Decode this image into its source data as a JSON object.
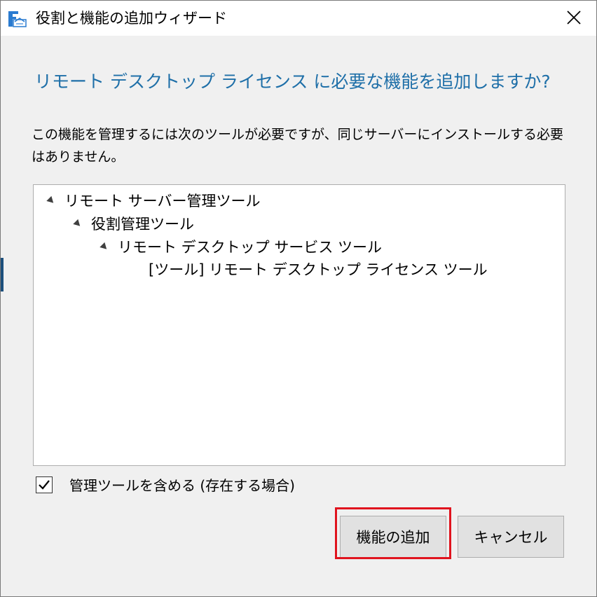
{
  "window": {
    "title": "役割と機能の追加ウィザード",
    "app_icon": "server-manager-icon",
    "close_icon": "close-icon"
  },
  "dialog": {
    "heading": "リモート デスクトップ ライセンス に必要な機能を追加しますか?",
    "description": "この機能を管理するには次のツールが必要ですが、同じサーバーにインストールする必要はありません。",
    "tree": [
      {
        "label": "リモート サーバー管理ツール",
        "level": 0,
        "expanded": true
      },
      {
        "label": "役割管理ツール",
        "level": 1,
        "expanded": true
      },
      {
        "label": "リモート デスクトップ サービス ツール",
        "level": 2,
        "expanded": true
      },
      {
        "label": "[ツール] リモート デスクトップ ライセンス ツール",
        "level": 3,
        "expanded": null
      }
    ],
    "include_tools": {
      "label": "管理ツールを含める (存在する場合)",
      "checked": true
    },
    "buttons": {
      "add_features": "機能の追加",
      "cancel": "キャンセル"
    },
    "highlight_color": "#e0141e",
    "heading_color": "#1e6fa8"
  }
}
